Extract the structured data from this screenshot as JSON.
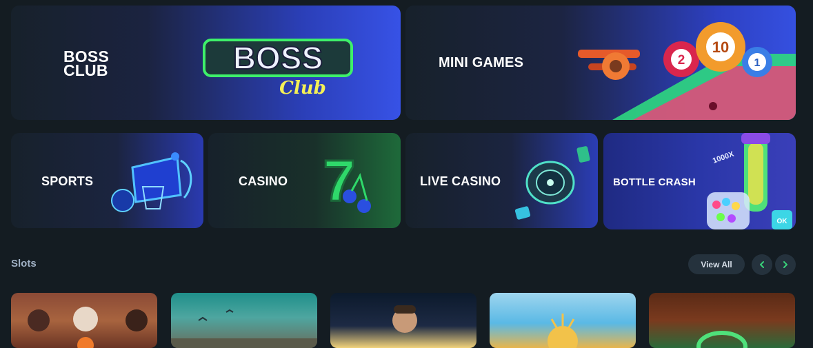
{
  "categories": {
    "boss_club": {
      "label": "BOSS CLUB",
      "logo_text": "BOSS",
      "logo_subtext": "Club"
    },
    "mini_games": {
      "label": "MINI GAMES",
      "balls": [
        "2",
        "10",
        "1"
      ]
    },
    "sports": {
      "label": "SPORTS"
    },
    "casino": {
      "label": "CASINO",
      "glyph": "7"
    },
    "live_casino": {
      "label": "LIVE CASINO"
    },
    "bottle_crash": {
      "label": "BOTTLE CRASH",
      "multiplier": "1000X",
      "badge": "OK"
    }
  },
  "slots_section": {
    "title": "Slots",
    "view_all_label": "View All",
    "prev_icon": "chevron-left-icon",
    "next_icon": "chevron-right-icon"
  },
  "colors": {
    "background": "#141c22",
    "accent_green": "#39d27a",
    "accent_blue": "#3752e6"
  }
}
